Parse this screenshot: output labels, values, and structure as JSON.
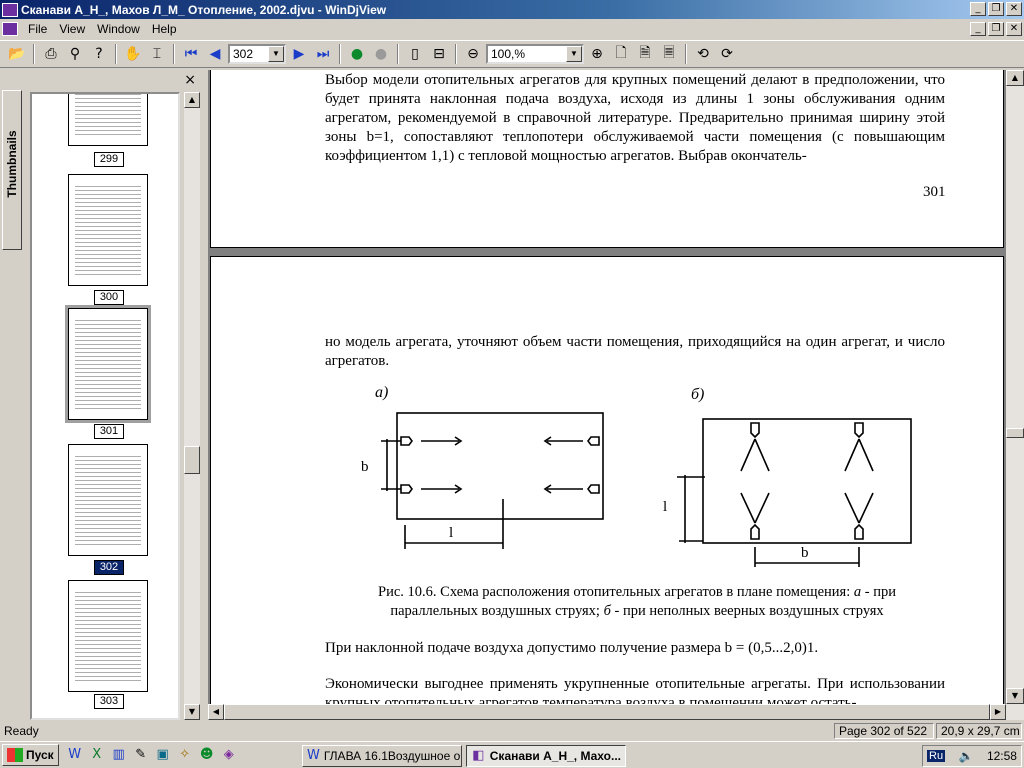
{
  "window": {
    "title": "Сканави А_Н_, Махов Л_М_ Отопление, 2002.djvu - WinDjView",
    "buttons": {
      "minimize": "_",
      "restore": "❐",
      "close": "✕"
    }
  },
  "menu": {
    "file": "File",
    "view": "View",
    "window": "Window",
    "help": "Help"
  },
  "toolbar": {
    "page_value": "302",
    "zoom_value": "100,%"
  },
  "sidebar": {
    "tab_label": "Thumbnails",
    "close": "×",
    "thumbnails": [
      {
        "label": "299",
        "selected": false
      },
      {
        "label": "300",
        "selected": false
      },
      {
        "label": "301",
        "selected": false
      },
      {
        "label": "302",
        "selected": true
      },
      {
        "label": "303",
        "selected": false
      }
    ]
  },
  "document": {
    "page1": {
      "paragraph": "Выбор модели отопительных агрегатов для крупных помещений делают в предположении, что будет принята наклонная подача воздуха, исходя из длины 1 зоны обслуживания одним агрегатом, рекомендуемой в справочной литературе. Предварительно принимая ширину этой зоны b=1, сопоставляют теплопотери обслуживаемой части помещения (с повышающим коэффициентом 1,1) с тепловой мощностью агрегатов. Выбрав окончатель-",
      "page_number": "301"
    },
    "page2": {
      "paragraph1": "но модель агрегата, уточняют объем части помещения, приходящийся на один агрегат, и число агрегатов.",
      "figure_a_label": "а)",
      "figure_b_label": "б)",
      "dim_b_a": "b",
      "dim_l_a": "l",
      "dim_l_b": "l",
      "dim_b_b": "b",
      "caption_prefix": "Рис. 10.6. Схема расположения отопительных агрегатов в плане помещения: ",
      "caption_a": "а",
      "caption_mid": " - при параллельных воздушных струях; ",
      "caption_b": "б",
      "caption_suffix": " - при неполных веерных воздушных струях",
      "paragraph2": "При наклонной подаче воздуха допустимо получение размера b = (0,5...2,0)1.",
      "paragraph3": "Экономически выгоднее применять укрупненные отопительные агрегаты. При использовании крупных отопительных агрегатов температура воздуха в помещении может остать-"
    }
  },
  "status": {
    "ready": "Ready",
    "page_info": "Page 302 of 522",
    "page_size": "20,9 x 29,7 cm"
  },
  "taskbar": {
    "start": "Пуск",
    "tasks": [
      {
        "label": "ГЛАВА 16.1Воздушное о...",
        "active": false
      },
      {
        "label": "Сканави А_Н_, Махо...",
        "active": true
      }
    ],
    "lang": "Ru",
    "clock": "12:58"
  }
}
